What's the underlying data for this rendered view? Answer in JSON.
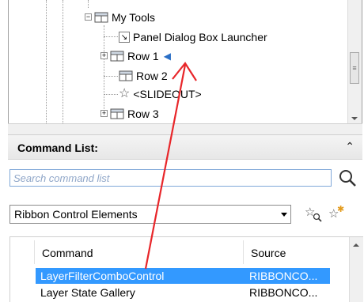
{
  "tree": {
    "items": [
      {
        "label": "My Tools"
      },
      {
        "label": "Panel Dialog Box Launcher"
      },
      {
        "label": "Row 1"
      },
      {
        "label": "Row 2"
      },
      {
        "label": "<SLIDEOUT>"
      },
      {
        "label": "Row 3"
      }
    ]
  },
  "command_list": {
    "title": "Command List:",
    "search_placeholder": "Search command list",
    "category": "Ribbon Control Elements",
    "columns": {
      "command": "Command",
      "source": "Source"
    },
    "rows": [
      {
        "command": "LayerFilterComboControl",
        "source": "RIBBONCO...",
        "selected": true
      },
      {
        "command": "Layer State Gallery",
        "source": "RIBBONCO...",
        "selected": false
      }
    ]
  },
  "colors": {
    "selection": "#3399ff",
    "annotation_arrow": "#e8262a",
    "marker_blue": "#2b6fc6"
  },
  "icons": [
    "expand-icon",
    "panel-icon",
    "dialog-launcher-icon",
    "star-icon",
    "search-icon",
    "find-command-icon",
    "new-command-icon",
    "chevron-double-up-icon"
  ]
}
